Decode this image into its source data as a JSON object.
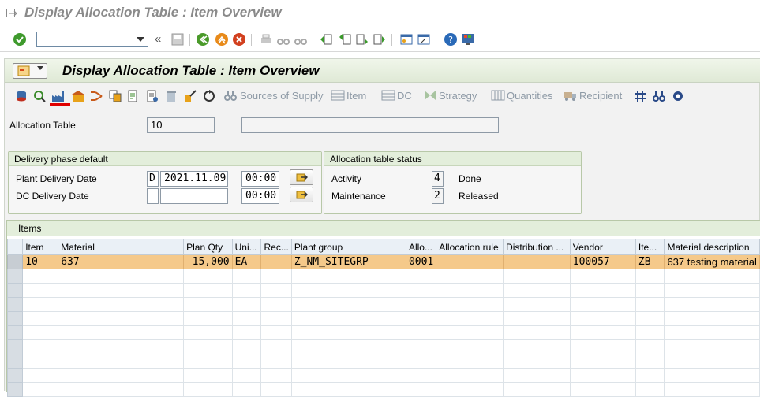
{
  "window": {
    "title": "Display Allocation Table : Item Overview"
  },
  "toolbar": {
    "command_value": ""
  },
  "screen": {
    "title": "Display Allocation Table : Item Overview",
    "app_toolbar": {
      "sources_of_supply": "Sources of Supply",
      "item": "Item",
      "dc": "DC",
      "strategy": "Strategy",
      "quantities": "Quantities",
      "recipient": "Recipient"
    }
  },
  "header": {
    "allocation_table_label": "Allocation Table",
    "allocation_table_value": "10",
    "description_value": ""
  },
  "delivery_phase": {
    "title": "Delivery phase default",
    "plant_label": "Plant Delivery Date",
    "plant_type": "D",
    "plant_date": "2021.11.09",
    "plant_time": "00:00",
    "dc_label": "DC Delivery Date",
    "dc_type": "",
    "dc_date": "",
    "dc_time": "00:00"
  },
  "status": {
    "title": "Allocation table status",
    "activity_label": "Activity",
    "activity_code": "4",
    "activity_text": "Done",
    "maintenance_label": "Maintenance",
    "maintenance_code": "2",
    "maintenance_text": "Released"
  },
  "items": {
    "title": "Items",
    "columns": [
      "Item",
      "Material",
      "Plan Qty",
      "Uni...",
      "Rec...",
      "Plant group",
      "Allo...",
      "Allocation rule",
      "Distribution ...",
      "Vendor",
      "Ite...",
      "Material description"
    ],
    "rows": [
      [
        "10",
        "637",
        "15,000",
        "EA",
        "",
        "Z_NM_SITEGRP",
        "0001",
        "",
        "",
        "100057",
        "ZB",
        "637 testing material"
      ]
    ]
  }
}
